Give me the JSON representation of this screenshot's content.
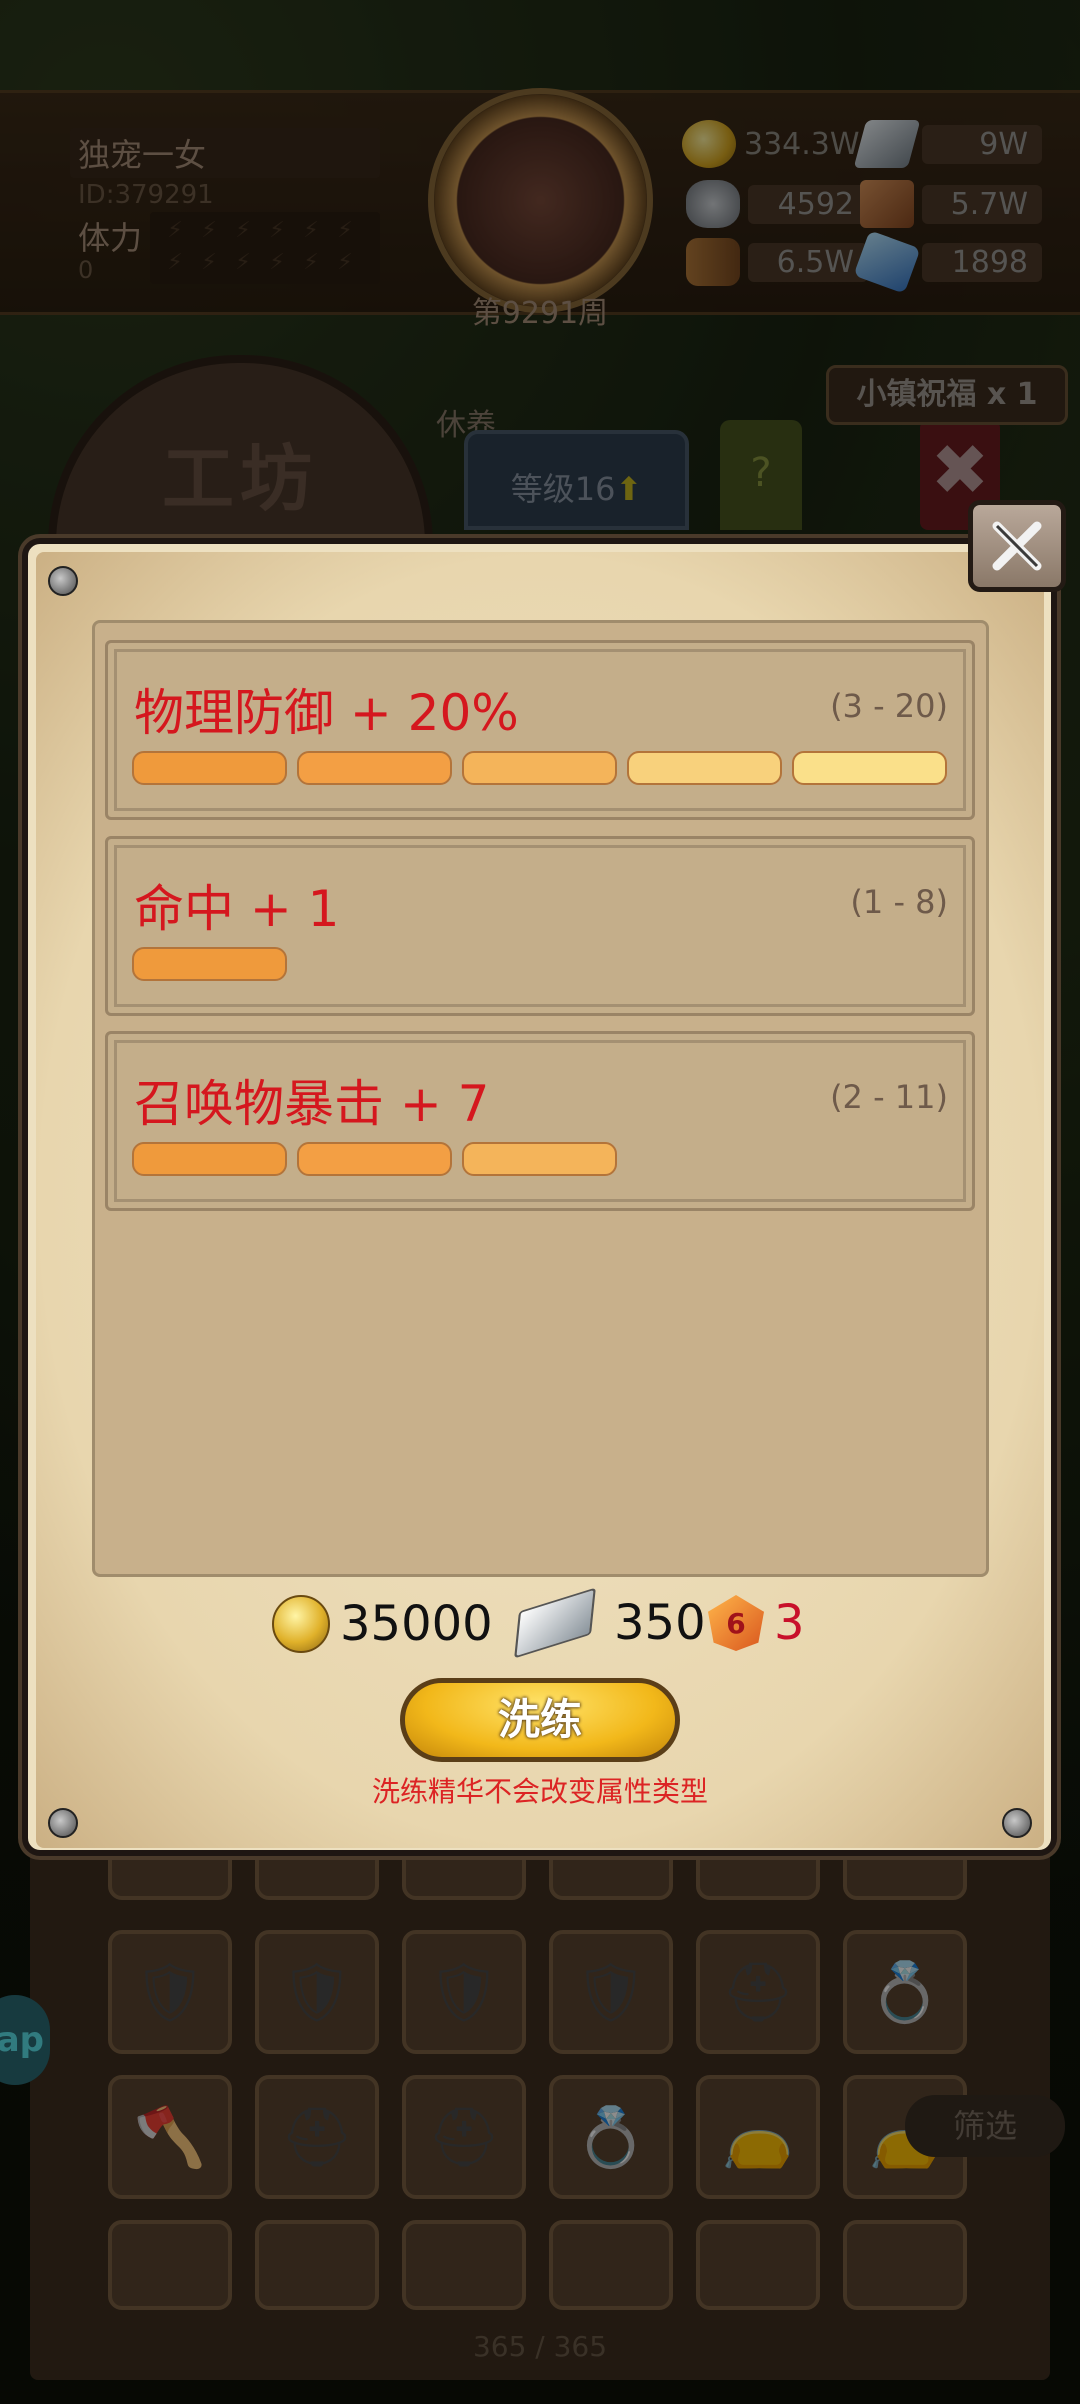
{
  "header": {
    "player_name": "独宠一女",
    "player_id": "ID:379291",
    "stamina_label": "体力",
    "stamina_value": "0",
    "week": "第9291周",
    "resources": {
      "gold": "334.3W",
      "steel": "9W",
      "stone": "4592",
      "leather": "5.7W",
      "wood": "6.5W",
      "crystal": "1898"
    },
    "town_blessing": "小镇祝福 x 1"
  },
  "workshop": {
    "title": "工坊",
    "rest_label": "休养",
    "level_label": "等级16",
    "help_label": "?",
    "close_label": "✖"
  },
  "modal": {
    "attributes": [
      {
        "name": "物理防御 + 20%",
        "range": "(3 - 20)",
        "level": 5
      },
      {
        "name": "命中 + 1",
        "range": "(1 - 8)",
        "level": 1
      },
      {
        "name": "召唤物暴击 + 7",
        "range": "(2 - 11)",
        "level": 3
      }
    ],
    "cost": {
      "gold": "35000",
      "steel": "350",
      "essence_icon_number": "6",
      "essence": "3"
    },
    "refine_button": "洗练",
    "note": "洗练精华不会改变属性类型"
  },
  "inventory": {
    "pager": "365 / 365",
    "filter_label": "筛选",
    "side_label": "ap"
  },
  "colors": {
    "attribute_text": "#d5171e",
    "pip_1": "#ef9a3c",
    "pip_5": "#fae08a",
    "refine_button": "#f2b81a"
  }
}
